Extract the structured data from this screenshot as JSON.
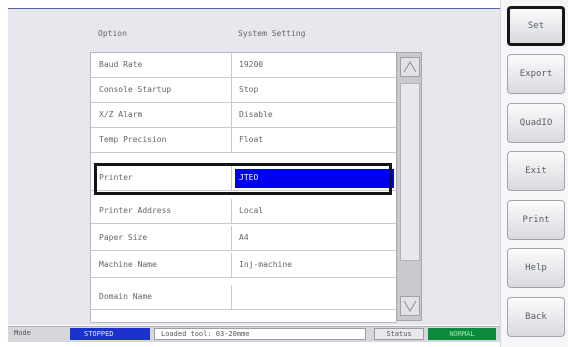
{
  "table": {
    "header_option": "Option",
    "header_setting": "System Setting",
    "rows": [
      {
        "option": "Baud Rate",
        "value": "19200"
      },
      {
        "option": "Console Startup",
        "value": "Stop"
      },
      {
        "option": "X/Z Alarm",
        "value": "Disable"
      },
      {
        "option": "Temp Precision",
        "value": "Float"
      },
      {
        "option": "Printer",
        "value": "JTEO",
        "selected": true
      },
      {
        "option": "Printer Address",
        "value": "Local"
      },
      {
        "option": "Paper Size",
        "value": "A4"
      },
      {
        "option": "Machine Name",
        "value": "Inj-machine"
      },
      {
        "option": "Domain Name",
        "value": ""
      }
    ]
  },
  "status_bar": {
    "mode_label": "Mode",
    "mode_value": "STOPPED",
    "message": "Loaded tool: 03-20mme",
    "status_label": "Status",
    "status_value": "NORMAL",
    "colors": {
      "mode": "#1b33cc",
      "status": "#0a8a3a"
    }
  },
  "sidebar": {
    "buttons": [
      {
        "label": "Set",
        "active": true
      },
      {
        "label": "Export"
      },
      {
        "label": "QuadIO"
      },
      {
        "label": "Exit"
      },
      {
        "label": "Print"
      },
      {
        "label": "Help"
      },
      {
        "label": "Back"
      }
    ]
  },
  "colors": {
    "selection": "#0000f0",
    "focus_border": "#141414"
  }
}
